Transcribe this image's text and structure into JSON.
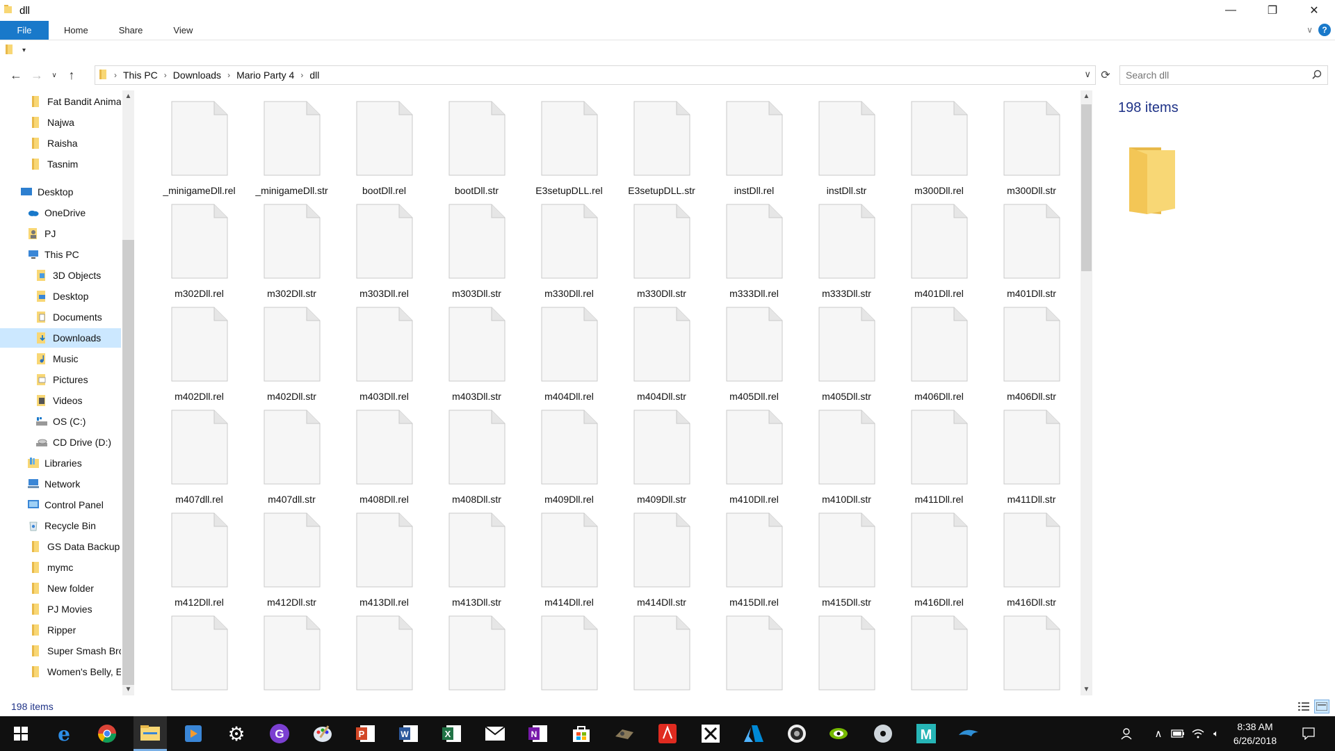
{
  "window": {
    "title": "dll",
    "minimize": "—",
    "maximize": "❐",
    "close": "✕"
  },
  "ribbon": {
    "tabs": [
      "File",
      "Home",
      "Share",
      "View"
    ]
  },
  "address": {
    "crumbs": [
      "This PC",
      "Downloads",
      "Mario Party 4",
      "dll"
    ],
    "separator": "›",
    "dropdown": "∨"
  },
  "search": {
    "placeholder": "Search dll"
  },
  "nav": {
    "items": [
      {
        "label": "Fat Bandit Anima",
        "icon": "folder-icon"
      },
      {
        "label": "Najwa",
        "icon": "folder-icon"
      },
      {
        "label": "Raisha",
        "icon": "folder-icon"
      },
      {
        "label": "Tasnim",
        "icon": "folder-icon"
      },
      {
        "label": "Desktop",
        "icon": "desktop-icon"
      },
      {
        "label": "OneDrive",
        "icon": "cloud-icon"
      },
      {
        "label": "PJ",
        "icon": "user-icon"
      },
      {
        "label": "This PC",
        "icon": "computer-icon"
      },
      {
        "label": "3D Objects",
        "icon": "cube-folder-icon"
      },
      {
        "label": "Desktop",
        "icon": "desktop-folder-icon"
      },
      {
        "label": "Documents",
        "icon": "documents-icon"
      },
      {
        "label": "Downloads",
        "icon": "downloads-icon"
      },
      {
        "label": "Music",
        "icon": "music-icon"
      },
      {
        "label": "Pictures",
        "icon": "pictures-icon"
      },
      {
        "label": "Videos",
        "icon": "videos-icon"
      },
      {
        "label": "OS (C:)",
        "icon": "drive-icon"
      },
      {
        "label": "CD Drive (D:)",
        "icon": "cd-drive-icon"
      },
      {
        "label": "Libraries",
        "icon": "libraries-icon"
      },
      {
        "label": "Network",
        "icon": "network-icon"
      },
      {
        "label": "Control Panel",
        "icon": "control-panel-icon"
      },
      {
        "label": "Recycle Bin",
        "icon": "recycle-bin-icon"
      },
      {
        "label": "GS Data Backup",
        "icon": "folder-icon"
      },
      {
        "label": "mymc",
        "icon": "folder-icon"
      },
      {
        "label": "New folder",
        "icon": "folder-icon"
      },
      {
        "label": "PJ Movies",
        "icon": "folder-icon"
      },
      {
        "label": "Ripper",
        "icon": "folder-icon"
      },
      {
        "label": "Super Smash Brc",
        "icon": "folder-icon"
      },
      {
        "label": "Women's Belly, E",
        "icon": "folder-icon"
      }
    ],
    "selected": "Downloads"
  },
  "files": [
    "_minigameDll.rel",
    "_minigameDll.str",
    "bootDll.rel",
    "bootDll.str",
    "E3setupDLL.rel",
    "E3setupDLL.str",
    "instDll.rel",
    "instDll.str",
    "m300Dll.rel",
    "m300Dll.str",
    "m302Dll.rel",
    "m302Dll.str",
    "m303Dll.rel",
    "m303Dll.str",
    "m330Dll.rel",
    "m330Dll.str",
    "m333Dll.rel",
    "m333Dll.str",
    "m401Dll.rel",
    "m401Dll.str",
    "m402Dll.rel",
    "m402Dll.str",
    "m403Dll.rel",
    "m403Dll.str",
    "m404Dll.rel",
    "m404Dll.str",
    "m405Dll.rel",
    "m405Dll.str",
    "m406Dll.rel",
    "m406Dll.str",
    "m407dll.rel",
    "m407dll.str",
    "m408Dll.rel",
    "m408Dll.str",
    "m409Dll.rel",
    "m409Dll.str",
    "m410Dll.rel",
    "m410Dll.str",
    "m411Dll.rel",
    "m411Dll.str",
    "m412Dll.rel",
    "m412Dll.str",
    "m413Dll.rel",
    "m413Dll.str",
    "m414Dll.rel",
    "m414Dll.str",
    "m415Dll.rel",
    "m415Dll.str",
    "m416Dll.rel",
    "m416Dll.str",
    "",
    "",
    "",
    "",
    "",
    "",
    "",
    "",
    "",
    ""
  ],
  "details": {
    "count": "198 items"
  },
  "status": {
    "count": "198 items"
  },
  "taskbar": {
    "time": "8:38 AM",
    "date": "6/26/2018",
    "apps": [
      "start-icon",
      "edge-icon",
      "chrome-icon",
      "file-explorer-icon",
      "media-player-icon",
      "settings-icon",
      "g-app-icon",
      "paint-icon",
      "powerpoint-icon",
      "word-icon",
      "excel-icon",
      "mail-icon",
      "onenote-icon",
      "store-icon",
      "game-icon",
      "pdf-icon",
      "x-app-icon",
      "azure-icon",
      "emblem-icon",
      "nvidia-icon",
      "disc-icon",
      "maya-icon",
      "dolphin-icon"
    ]
  },
  "colors": {
    "accent": "#1979ca",
    "selection": "#cce8ff",
    "folder": "#f8d775",
    "taskbar": "#101010",
    "status_text": "#1e3287"
  }
}
